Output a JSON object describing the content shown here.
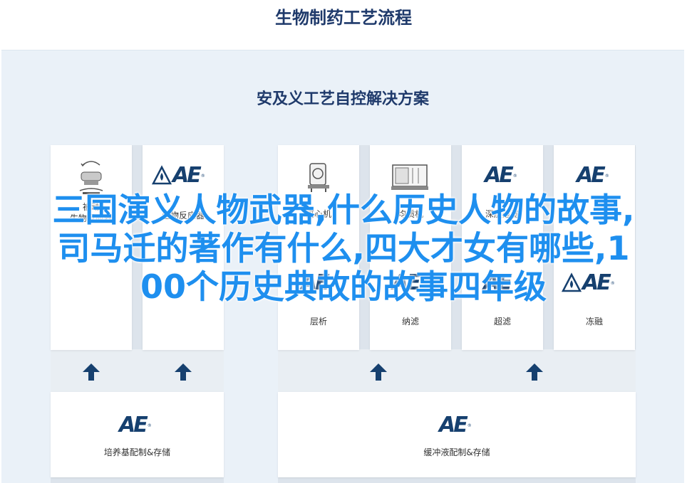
{
  "header": {
    "title": "生物制药工艺流程"
  },
  "panel": {
    "title": "安及义工艺自控解决方案"
  },
  "logo_text": "AE",
  "logo_reg": "®",
  "cards_top": [
    {
      "label_line1": "被动",
      "label_line2": "生物反应器",
      "icon": "agitator-icon"
    },
    {
      "label_line1": "生物反应器",
      "icon": "ae-logo"
    },
    {
      "label_line1": "离心机",
      "icon": "centrifuge-icon"
    },
    {
      "label_line1": "均质机",
      "icon": "homogenizer-icon"
    },
    {
      "label_line1": "深层过滤",
      "icon": "ae-logo"
    },
    {
      "label_line1": "",
      "icon": "ae-logo"
    }
  ],
  "cards_mid": [
    {
      "label": "层析"
    },
    {
      "label": "纳滤"
    },
    {
      "label": "超滤"
    },
    {
      "label": "冻融"
    }
  ],
  "cards_bottom": [
    {
      "label": "培养基配制&存储"
    },
    {
      "label": "缓冲液配制&存储"
    }
  ],
  "overlay": {
    "line1": "三国演义人物武器,什么历史人物的故事,",
    "line2": "司马迁的著作有什么,四大才女有哪些,1",
    "line3": "00个历史典故的故事四年级"
  }
}
